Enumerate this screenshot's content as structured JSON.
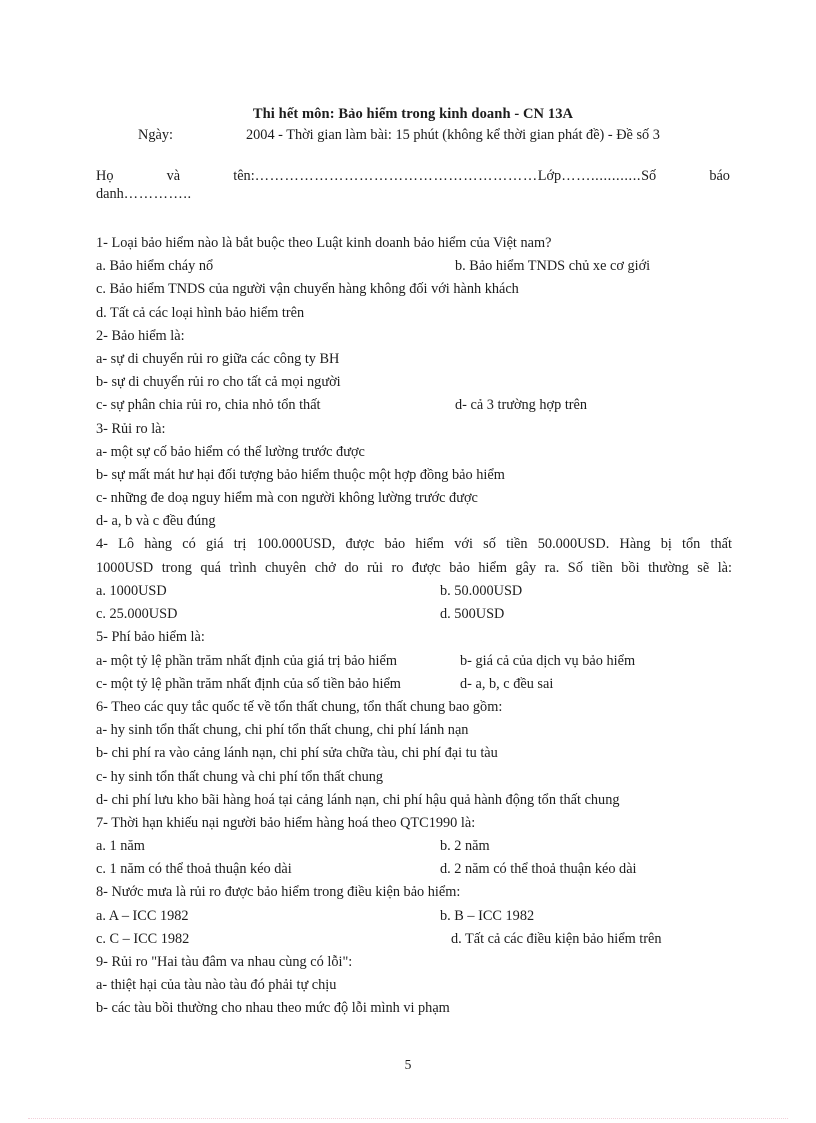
{
  "document": {
    "page_number": "5",
    "header": {
      "title": "Thi hết môn: Bảo hiểm trong kinh doanh - CN 13A",
      "date_label": "Ngày:",
      "date_rest": "2004 - Thời gian làm bài: 15 phút (không kể thời gian phát đề) - Đề số 3"
    },
    "student_info": {
      "name_label": "Họ",
      "name_and": "và",
      "name_ten": "tên:",
      "dots_after_name": "…………………………………………………",
      "class_label": "Lớp",
      "dots_after_class": "……............",
      "so_label": "Số",
      "bao_label": "báo",
      "danh_label": "danh",
      "dots_after_danh": "………….."
    },
    "questions": [
      {
        "number": "1",
        "stem": "1- Loại bảo hiểm nào là bắt buộc theo Luật kinh doanh bảo hiểm của Việt nam?",
        "rows": [
          {
            "left": "a. Bảo hiểm cháy nổ",
            "right": "b. Bảo hiểm TNDS chủ xe cơ giới",
            "right_x": "c-455"
          },
          {
            "left": "c. Bảo hiểm TNDS của người vận chuyển hàng không đối với hành khách",
            "right": "",
            "right_x": ""
          },
          {
            "left": "d. Tất cả các loại hình bảo hiểm trên",
            "right": "",
            "right_x": ""
          }
        ]
      },
      {
        "number": "2",
        "stem": "2- Bảo hiểm là:",
        "rows": [
          {
            "left": "a- sự di chuyển rủi ro giữa các công ty BH",
            "right": "",
            "right_x": ""
          },
          {
            "left": "b- sự di chuyển rủi ro cho tất cả mọi người",
            "right": "",
            "right_x": ""
          },
          {
            "left": "c- sự phân chia rủi ro, chia nhỏ tổn thất",
            "right": "d- cả 3 trường hợp trên",
            "right_x": "c-455"
          }
        ]
      },
      {
        "number": "3",
        "stem": "3- Rủi ro là:",
        "rows": [
          {
            "left": "a- một sự cố bảo hiểm có thể lường trước được",
            "right": "",
            "right_x": ""
          },
          {
            "left": "b- sự mất mát hư hại đối tượng bảo hiểm thuộc một hợp đồng bảo hiểm",
            "right": "",
            "right_x": ""
          },
          {
            "left": "c- những đe doạ nguy hiểm mà con người không lường trước được",
            "right": "",
            "right_x": ""
          },
          {
            "left": "d- a, b và c đều đúng",
            "right": "",
            "right_x": ""
          }
        ]
      },
      {
        "number": "4",
        "stem_line1": "4- Lô hàng có giá trị 100.000USD, được bảo hiểm với số tiền 50.000USD. Hàng bị tổn thất",
        "stem_line2": "1000USD trong quá trình chuyên chở do rủi ro được bảo hiểm gây ra. Số tiền bồi thường sẽ là:",
        "rows": [
          {
            "left": "a. 1000USD",
            "right": "b. 50.000USD",
            "right_x": "c-340"
          },
          {
            "left": "c. 25.000USD",
            "right": "d. 500USD",
            "right_x": "c-340"
          }
        ]
      },
      {
        "number": "5",
        "stem": "5- Phí bảo hiểm là:",
        "rows": [
          {
            "left": "a- một tỷ lệ phần trăm nhất định của giá trị bảo hiểm",
            "right": "b- giá cả của dịch vụ bảo hiểm",
            "right_x": "c-460"
          },
          {
            "left": "c- một tỷ lệ phần trăm nhất định của số tiền bảo hiểm",
            "right": "d- a, b, c đều sai",
            "right_x": "c-460"
          }
        ]
      },
      {
        "number": "6",
        "stem": "6- Theo các quy tắc quốc tế về tổn thất chung, tổn thất chung bao gồm:",
        "rows": [
          {
            "left": "a- hy sinh tổn thất chung, chi phí tổn thất chung, chi phí lánh nạn",
            "right": "",
            "right_x": ""
          },
          {
            "left": "b- chi phí ra vào cảng lánh nạn, chi phí sửa chữa tàu, chi phí đại tu tàu",
            "right": "",
            "right_x": ""
          },
          {
            "left": "c- hy sinh tổn thất chung và chi phí tổn thất chung",
            "right": "",
            "right_x": ""
          },
          {
            "left": "d- chi phí lưu kho bãi hàng hoá tại cảng lánh nạn, chi phí hậu quả hành động tổn thất chung",
            "right": "",
            "right_x": ""
          }
        ]
      },
      {
        "number": "7",
        "stem": "7- Thời hạn khiếu nại người bảo hiểm hàng hoá theo QTC1990 là:",
        "rows": [
          {
            "left": "a. 1 năm",
            "right": "b. 2 năm",
            "right_x": "c-340"
          },
          {
            "left": "c. 1 năm có thể thoả thuận kéo dài",
            "right": "d. 2 năm có thể thoả thuận kéo dài",
            "right_x": "c-340"
          }
        ]
      },
      {
        "number": "8",
        "stem": "8- Nước mưa là rủi ro được bảo hiểm trong điều kiện bảo hiểm:",
        "rows": [
          {
            "left": "a. A – ICC 1982",
            "right": "b. B – ICC 1982",
            "right_x": "c-340"
          },
          {
            "left": "c. C – ICC 1982",
            "right": "d. Tất cả các điều kiện bảo hiểm trên",
            "right_x": "c-350"
          }
        ]
      },
      {
        "number": "9",
        "stem": "9- Rủi ro \"Hai tàu đâm va nhau cùng có lỗi\":",
        "rows": [
          {
            "left": "a- thiệt hại của tàu nào tàu đó phải tự chịu",
            "right": "",
            "right_x": ""
          },
          {
            "left": "b- các tàu bồi thường cho nhau theo mức độ lỗi mình vi phạm",
            "right": "",
            "right_x": ""
          }
        ]
      }
    ]
  }
}
